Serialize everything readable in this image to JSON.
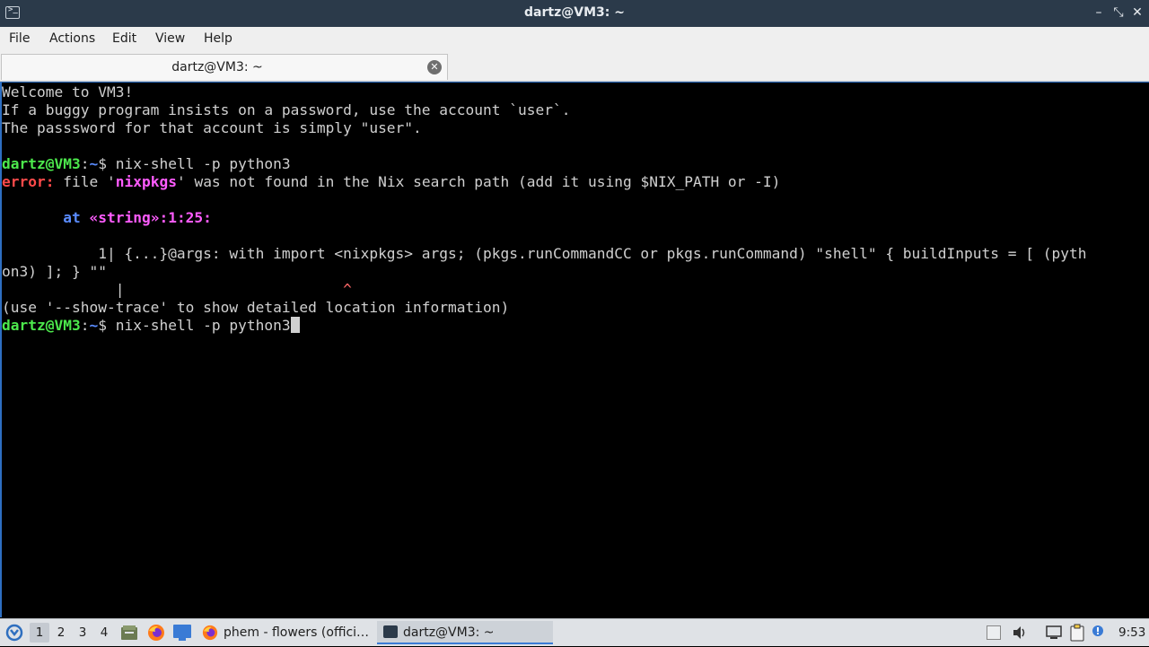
{
  "window": {
    "title": "dartz@VM3: ~",
    "controls": {
      "minimize": "–",
      "maximize": "⤡",
      "close": "✕"
    }
  },
  "menubar": {
    "file": "File",
    "actions": "Actions",
    "edit": "Edit",
    "view": "View",
    "help": "Help"
  },
  "tabs": [
    {
      "label": "dartz@VM3: ~",
      "close": "✕"
    }
  ],
  "terminal": {
    "welcome": [
      "Welcome to VM3!",
      "If a buggy program insists on a password, use the account `user`.",
      "The passsword for that account is simply \"user\"."
    ],
    "prompt_user": "dartz@VM3",
    "prompt_colon": ":",
    "prompt_path": "~",
    "prompt_symbol": "$ ",
    "command1": "nix-shell -p python3",
    "error_label": "error:",
    "error_pre": " file '",
    "error_pkg": "nixpkgs",
    "error_post": "' was not found in the Nix search path (add it using $NIX_PATH or -I)",
    "at_indent": "       ",
    "at_word": "at ",
    "at_loc": "«string»:1:25:",
    "code_line1": "           1| {...}@args: with import <nixpkgs> args; (pkgs.runCommandCC or pkgs.runCommand) \"shell\" { buildInputs = [ (pyth",
    "code_line2": "on3) ]; } \"\"",
    "marker_pipe": "             |",
    "marker_gap": "                         ",
    "marker_caret": "^",
    "hint": "(use '--show-trace' to show detailed location information)",
    "command2": "nix-shell -p python3"
  },
  "taskbar": {
    "workspaces": [
      "1",
      "2",
      "3",
      "4"
    ],
    "active_workspace": "1",
    "tasks": [
      {
        "label": "phem - flowers (offici…",
        "icon": "firefox-icon"
      },
      {
        "label": "dartz@VM3: ~",
        "icon": "terminal-icon"
      }
    ],
    "clock": "9:53"
  },
  "colors": {
    "titlebar": "#2b3a4a",
    "prompt_user": "#4ce84c",
    "prompt_path": "#5a8cff",
    "error": "#ff4a4a",
    "highlight": "#ff5cff",
    "accent": "#3a7bd5"
  }
}
